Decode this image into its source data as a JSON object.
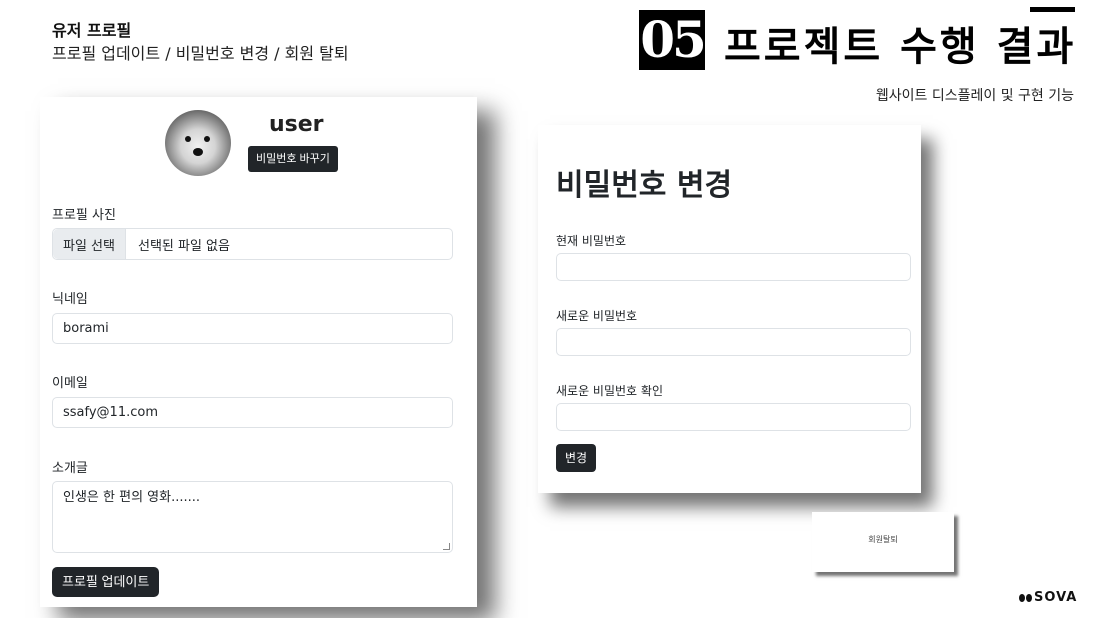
{
  "header": {
    "title": "유저 프로필",
    "subtitle": "프로필 업데이트 / 비밀번호 변경 / 회원 탈퇴"
  },
  "section": {
    "number": "05",
    "title": "프로젝트 수행 결과",
    "subtitle": "웹사이트 디스플레이 및 구현 기능"
  },
  "profile": {
    "username": "user",
    "change_password_button": "비밀번호 바꾸기",
    "photo_label": "프로필 사진",
    "file_button": "파일 선택",
    "file_status": "선택된 파일 없음",
    "nickname_label": "닉네임",
    "nickname_value": "borami",
    "email_label": "이메일",
    "email_value": "ssafy@11.com",
    "bio_label": "소개글",
    "bio_value": "인생은 한 편의 영화.......",
    "update_button": "프로필 업데이트"
  },
  "password_form": {
    "title": "비밀번호 변경",
    "current_label": "현재 비밀번호",
    "new_label": "새로운 비밀번호",
    "confirm_label": "새로운 비밀번호 확인",
    "submit_button": "변경"
  },
  "withdraw": {
    "label": "회원탈퇴"
  },
  "logo": {
    "text": "SOVA"
  }
}
